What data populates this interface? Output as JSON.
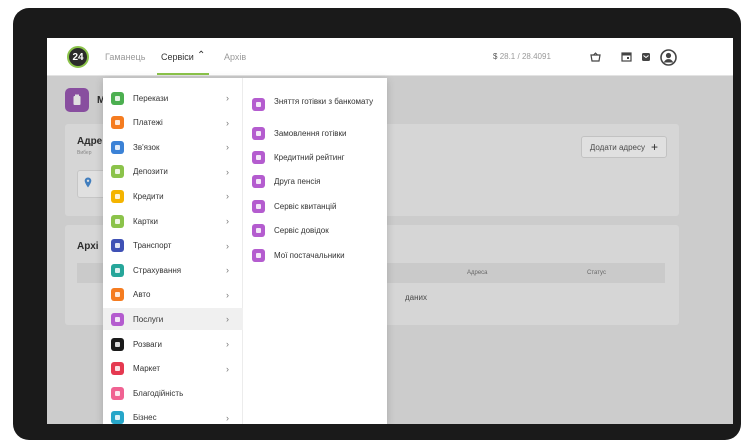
{
  "topbar": {
    "logo_text": "24",
    "nav": [
      {
        "label": "Гаманець"
      },
      {
        "label": "Сервіси"
      },
      {
        "label": "Архів"
      }
    ],
    "nav_expand_icon": "chevron-up-icon",
    "rates": {
      "usd_symbol": "$",
      "usd": "28.1",
      "sep": "/",
      "rate2": "28.4091"
    },
    "icons": [
      "cart-icon",
      "calendar-icon",
      "mail-icon",
      "avatar-icon"
    ]
  },
  "page": {
    "title_stub": "М",
    "address_card": {
      "title": "Адре",
      "subtitle": "Вибер",
      "add_button": "Додати адресу",
      "add_icon": "plus-icon"
    },
    "archive_card": {
      "title": "Архі",
      "columns": [
        "Адреса",
        "Статус"
      ],
      "no_data": "даних"
    }
  },
  "menu": {
    "categories": [
      {
        "label": "Перекази",
        "color": "#4caf50",
        "chevron": "›"
      },
      {
        "label": "Платежі",
        "color": "#f57c20",
        "chevron": "›"
      },
      {
        "label": "Зв'язок",
        "color": "#3b82d6",
        "chevron": "›"
      },
      {
        "label": "Депозити",
        "color": "#8bc34a",
        "chevron": "›"
      },
      {
        "label": "Кредити",
        "color": "#f4b400",
        "chevron": "›"
      },
      {
        "label": "Картки",
        "color": "#8bc34a",
        "chevron": "›"
      },
      {
        "label": "Транспорт",
        "color": "#3f51b5",
        "chevron": "›"
      },
      {
        "label": "Страхування",
        "color": "#26a69a",
        "chevron": "›"
      },
      {
        "label": "Авто",
        "color": "#f57c20",
        "chevron": "›"
      },
      {
        "label": "Послуги",
        "color": "#b45ccf",
        "chevron": "›"
      },
      {
        "label": "Розваги",
        "color": "#1a1a1a",
        "chevron": "›"
      },
      {
        "label": "Маркет",
        "color": "#e53950",
        "chevron": "›"
      },
      {
        "label": "Благодійність",
        "color": "#f06292",
        "chevron": ""
      },
      {
        "label": "Бізнес",
        "color": "#26a6c9",
        "chevron": "›"
      }
    ],
    "selected_index": 9,
    "services": [
      {
        "label": "Зняття готівки з банкомату"
      },
      {
        "label": "Замовлення готівки"
      },
      {
        "label": "Кредитний рейтинг"
      },
      {
        "label": "Друга пенсія"
      },
      {
        "label": "Сервіс квитанцій"
      },
      {
        "label": "Сервіс довідок"
      },
      {
        "label": "Мої постачальники"
      }
    ]
  }
}
